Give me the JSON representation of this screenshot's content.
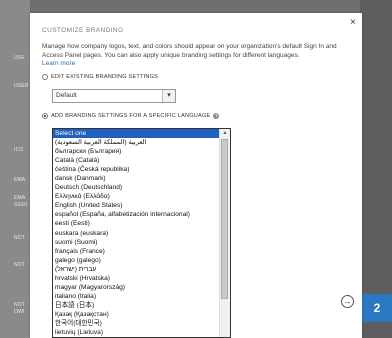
{
  "background": {
    "labels": [
      "USE",
      "USER",
      "ICO",
      "EMA",
      "EMA",
      "SIGN",
      "NOT",
      "NOT",
      "NOT",
      "OWI"
    ],
    "side_tab_number": "2"
  },
  "dialog": {
    "title": "CUSTOMIZE BRANDING",
    "description": "Manage how company logos, text, and colors should appear on your organization's default Sign In and Access Panel pages. You can also apply unique branding settings for different languages.",
    "learn_more": "Learn more",
    "close_symbol": "×",
    "option_edit_existing": "EDIT EXISTING BRANDING SETTINGS",
    "default_select_value": "Default",
    "option_add_language": "ADD BRANDING SETTINGS FOR A SPECIFIC LANGUAGE",
    "help_symbol": "?",
    "next_symbol": "→",
    "languages": [
      "Select one",
      "العربية (المملكة العربية السعودية)",
      "български (България)",
      "Català (Català)",
      "čeština (Česká republika)",
      "dansk (Danmark)",
      "Deutsch (Deutschland)",
      "Ελληνικά (Ελλάδα)",
      "English (United States)",
      "español (España, alfabetización internacional)",
      "eesti (Eesti)",
      "euskara (euskara)",
      "suomi (Suomi)",
      "français (France)",
      "galego (galego)",
      "עברית (ישראל)",
      "hrvatski (Hrvatska)",
      "magyar (Magyarország)",
      "italiano (Italia)",
      "日本語 (日本)",
      "Қазақ (Қазақстан)",
      "한국어(대한민국)",
      "lietuvių (Lietuva)"
    ]
  }
}
